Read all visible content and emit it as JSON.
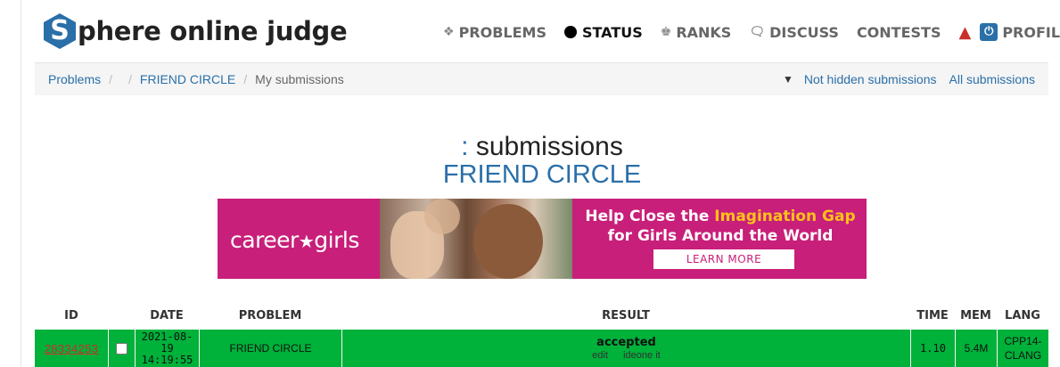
{
  "logo": {
    "letter": "S",
    "text": "phere online judge"
  },
  "nav": {
    "problems": "PROBLEMS",
    "status": "STATUS",
    "ranks": "RANKS",
    "discuss": "DISCUSS",
    "contests": "CONTESTS",
    "profile": "PROFILE"
  },
  "breadcrumb": {
    "problems": "Problems",
    "empty": "",
    "problem": "FRIEND CIRCLE",
    "current": "My submissions",
    "not_hidden": "Not hidden submissions",
    "all": "All submissions"
  },
  "heading": {
    "colon": ":",
    "title": "submissions",
    "problem": "FRIEND CIRCLE"
  },
  "ad": {
    "brand": "career",
    "brand2": "girls",
    "line1_a": "Help Close the ",
    "line1_hl": "Imagination Gap",
    "line2": "for Girls Around the World",
    "button": "LEARN MORE"
  },
  "table": {
    "headers": {
      "id": "ID",
      "date": "DATE",
      "problem": "PROBLEM",
      "result": "RESULT",
      "time": "TIME",
      "mem": "MEM",
      "lang": "LANG"
    },
    "rows": [
      {
        "id": "28334253",
        "date": "2021-08-19",
        "time_of_day": "14:19:55",
        "problem": "FRIEND CIRCLE",
        "result": "accepted",
        "edit": "edit",
        "ideone": "ideone it",
        "time": "1.10",
        "mem": "5.4M",
        "lang_1": "CPP14-",
        "lang_2": "CLANG"
      }
    ]
  },
  "colors": {
    "accent": "#2a6fa8",
    "accepted": "#00b13a",
    "ad_bg": "#c81f7a",
    "ad_highlight": "#ffc21a"
  }
}
